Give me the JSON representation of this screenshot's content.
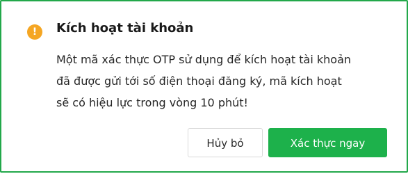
{
  "dialog": {
    "icon": "warning-icon",
    "icon_glyph": "!",
    "title": "Kích hoạt tài khoản",
    "message_lines": [
      "Một mã xác thực OTP sử dụng để kích hoạt tài khoản",
      "đã được gửi tới số điện thoại đăng ký, mã kích hoạt",
      "sẽ có hiệu lực trong vòng 10 phút!"
    ],
    "cancel_label": "Hủy bỏ",
    "confirm_label": "Xác thực ngay"
  },
  "colors": {
    "border": "#22a84a",
    "warning": "#f5a623",
    "primary": "#1db14b"
  }
}
